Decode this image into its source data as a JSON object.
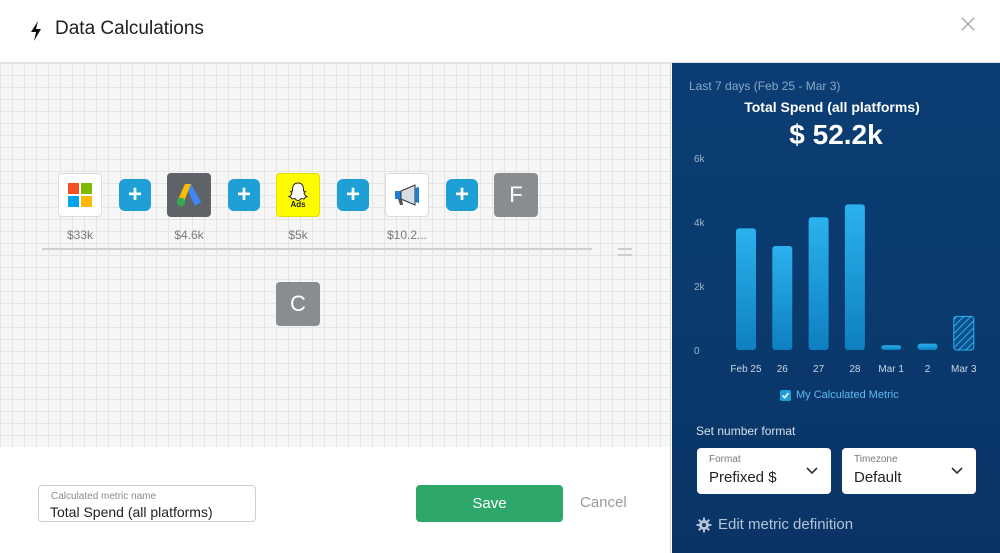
{
  "header": {
    "title": "Data Calculations",
    "title_icon": "bolt-icon",
    "close_icon": "close-icon"
  },
  "canvas": {
    "sources": [
      {
        "name": "microsoft-icon",
        "amount": "$33k"
      },
      {
        "name": "google-ads-icon",
        "amount": "$4.6k"
      },
      {
        "name": "snapchat-ads-icon",
        "amount": "$5k",
        "badge": "Ads"
      },
      {
        "name": "megaphone-icon",
        "amount": "$10.2..."
      }
    ],
    "plus_label": "+",
    "result_letter": "F",
    "constant_letter": "C"
  },
  "form": {
    "name_label": "Calculated metric name",
    "name_value": "Total Spend (all platforms)",
    "save_label": "Save",
    "cancel_label": "Cancel"
  },
  "panel": {
    "date_range": "Last 7 days (Feb 25 - Mar 3)",
    "metric_title": "Total Spend (all platforms)",
    "metric_value": "$ 52.2k",
    "legend_label": "My Calculated Metric",
    "format_label": "Set number format",
    "format_dropdown": {
      "label": "Format",
      "value": "Prefixed $"
    },
    "timezone_dropdown": {
      "label": "Timezone",
      "value": "Default"
    },
    "edit_label": "Edit metric definition",
    "colors": {
      "bar": "#1e9fd6",
      "bar_top": "#2bb2ee",
      "panel": "#0b3d74"
    }
  },
  "chart_data": {
    "type": "bar",
    "categories": [
      "Feb 25",
      "26",
      "27",
      "28",
      "Mar 1",
      "2",
      "Mar 3"
    ],
    "values": [
      3800,
      3250,
      4150,
      4550,
      150,
      200,
      1050
    ],
    "partial": [
      false,
      false,
      false,
      false,
      false,
      false,
      true
    ],
    "yticks": [
      "6k",
      "4k",
      "2k",
      "0"
    ],
    "ylim": [
      0,
      6000
    ],
    "series": [
      {
        "name": "My Calculated Metric",
        "values": [
          3800,
          3250,
          4150,
          4550,
          150,
          200,
          1050
        ]
      }
    ]
  }
}
